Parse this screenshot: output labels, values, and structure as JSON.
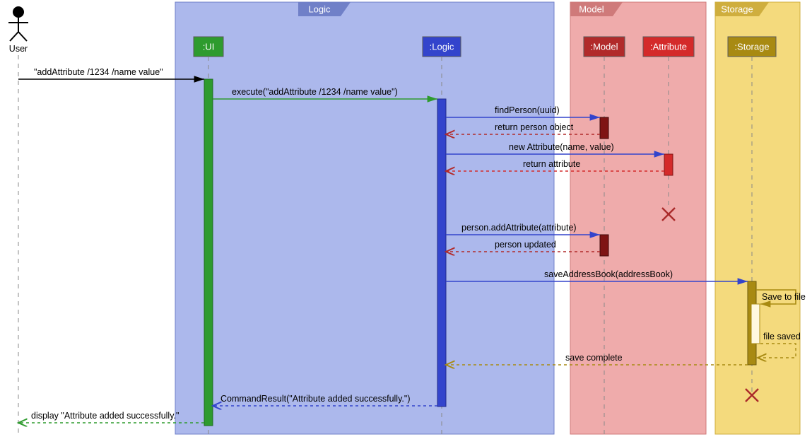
{
  "actor": {
    "name": "User"
  },
  "frames": {
    "logic": {
      "title": "Logic"
    },
    "model": {
      "title": "Model"
    },
    "storage": {
      "title": "Storage"
    }
  },
  "lifelines": {
    "ui": {
      "label": ":UI",
      "color": "#2e9b2e"
    },
    "logic": {
      "label": ":Logic",
      "color": "#3344cc"
    },
    "model": {
      "label": ":Model",
      "color": "#b12a2a"
    },
    "attribute": {
      "label": ":Attribute",
      "color": "#d42a2a"
    },
    "storage": {
      "label": ":Storage",
      "color": "#a88a12"
    }
  },
  "messages": {
    "m1": "\"addAttribute /1234 /name value\"",
    "m2": "execute(\"addAttribute /1234 /name value\")",
    "m3": "findPerson(uuid)",
    "m4": "return person object",
    "m5": "new Attribute(name, value)",
    "m6": "return attribute",
    "m7": "person.addAttribute(attribute)",
    "m8": "person updated",
    "m9": "saveAddressBook(addressBook)",
    "m10": "Save to file",
    "m11": "file saved",
    "m12": "save complete",
    "m13": "CommandResult(\"Attribute added successfully.\")",
    "m14": "display \"Attribute added successfully.\""
  }
}
